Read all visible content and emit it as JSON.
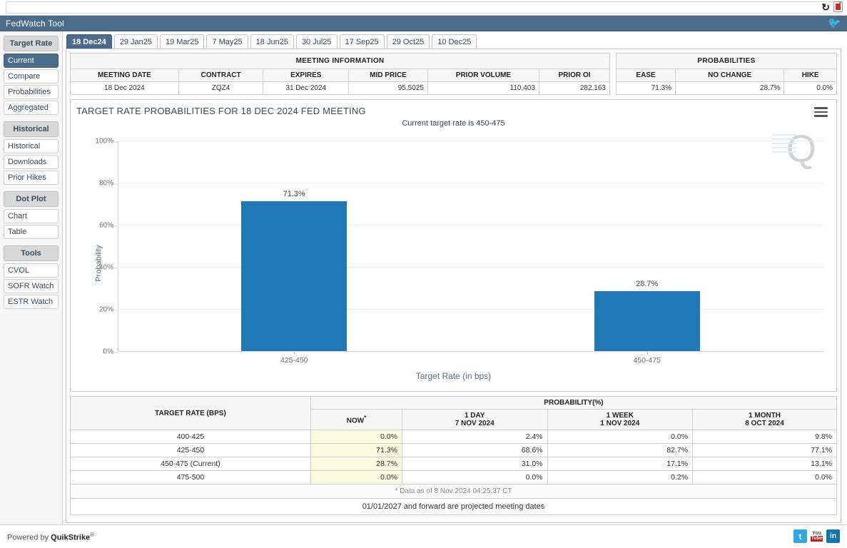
{
  "browser": {
    "reload_icon": "reload-icon",
    "pdf_icon": "pdf-icon"
  },
  "titlebar": {
    "title": "FedWatch Tool",
    "twitter_icon": "twitter-icon"
  },
  "sidebar": {
    "groups": [
      {
        "header": "Target Rate",
        "items": [
          {
            "label": "Current",
            "active": true
          },
          {
            "label": "Compare",
            "active": false
          },
          {
            "label": "Probabilities",
            "active": false
          },
          {
            "label": "Aggregated",
            "active": false
          }
        ]
      },
      {
        "header": "Historical",
        "items": [
          {
            "label": "Historical",
            "active": false
          },
          {
            "label": "Downloads",
            "active": false
          },
          {
            "label": "Prior Hikes",
            "active": false
          }
        ]
      },
      {
        "header": "Dot Plot",
        "items": [
          {
            "label": "Chart",
            "active": false
          },
          {
            "label": "Table",
            "active": false
          }
        ]
      },
      {
        "header": "Tools",
        "items": [
          {
            "label": "CVOL",
            "active": false
          },
          {
            "label": "SOFR Watch",
            "active": false
          },
          {
            "label": "ESTR Watch",
            "active": false
          }
        ]
      }
    ]
  },
  "tabs": [
    {
      "label": "18 Dec24",
      "active": true
    },
    {
      "label": "29 Jan25",
      "active": false
    },
    {
      "label": "19 Mar25",
      "active": false
    },
    {
      "label": "7 May25",
      "active": false
    },
    {
      "label": "18 Jun25",
      "active": false
    },
    {
      "label": "30 Jul25",
      "active": false
    },
    {
      "label": "17 Sep25",
      "active": false
    },
    {
      "label": "29 Oct25",
      "active": false
    },
    {
      "label": "10 Dec25",
      "active": false
    }
  ],
  "meeting_information": {
    "group_header": "MEETING INFORMATION",
    "columns": [
      "MEETING DATE",
      "CONTRACT",
      "EXPIRES",
      "MID PRICE",
      "PRIOR VOLUME",
      "PRIOR OI"
    ],
    "values": [
      "18 Dec 2024",
      "ZQZ4",
      "31 Dec 2024",
      "95.5025",
      "110,403",
      "282,163"
    ]
  },
  "probabilities_summary": {
    "group_header": "PROBABILITIES",
    "columns": [
      "EASE",
      "NO CHANGE",
      "HIKE"
    ],
    "values": [
      "71.3%",
      "28.7%",
      "0.0%"
    ]
  },
  "chart_data": {
    "type": "bar",
    "title": "TARGET RATE PROBABILITIES FOR 18 DEC 2024 FED MEETING",
    "subtitle": "Current target rate is 450-475",
    "categories": [
      "425-450",
      "450-475"
    ],
    "values": [
      71.3,
      28.7
    ],
    "value_labels": [
      "71.3%",
      "28.7%"
    ],
    "xlabel": "Target Rate (in bps)",
    "ylabel": "Probability",
    "ylim": [
      0,
      100
    ],
    "yticks": [
      0,
      20,
      40,
      60,
      80,
      100
    ],
    "ytick_labels": [
      "0%",
      "20%",
      "40%",
      "60%",
      "80%",
      "100%"
    ],
    "grid": true,
    "legend": "none",
    "bar_color": "#2079b4",
    "watermark": "Q",
    "menu_icon": "hamburger-menu-icon"
  },
  "probability_table": {
    "rate_header": "TARGET RATE (BPS)",
    "group_header": "PROBABILITY(%)",
    "columns": [
      {
        "line1": "NOW",
        "line2": "",
        "highlight": true
      },
      {
        "line1": "1 DAY",
        "line2": "7 NOV 2024",
        "highlight": false
      },
      {
        "line1": "1 WEEK",
        "line2": "1 NOV 2024",
        "highlight": false
      },
      {
        "line1": "1 MONTH",
        "line2": "8 OCT 2024",
        "highlight": false
      }
    ],
    "rows": [
      {
        "rate": "400-425",
        "now": "0.0%",
        "day": "2.4%",
        "week": "0.0%",
        "month": "9.8%"
      },
      {
        "rate": "425-450",
        "now": "71.3%",
        "day": "68.6%",
        "week": "82.7%",
        "month": "77.1%"
      },
      {
        "rate": "450-475 (Current)",
        "now": "28.7%",
        "day": "31.0%",
        "week": "17.1%",
        "month": "13.1%"
      },
      {
        "rate": "475-500",
        "now": "0.0%",
        "day": "0.0%",
        "week": "0.2%",
        "month": "0.0%"
      }
    ],
    "footnote": "* Data as of 8 Nov 2024 04:25:37 CT",
    "note": "01/01/2027 and forward are projected meeting dates"
  },
  "footer": {
    "powered_by_prefix": "Powered by ",
    "brand": "QuikStrike",
    "registered_mark": "®",
    "social": [
      "twitter-icon",
      "youtube-icon",
      "linkedin-icon"
    ]
  }
}
